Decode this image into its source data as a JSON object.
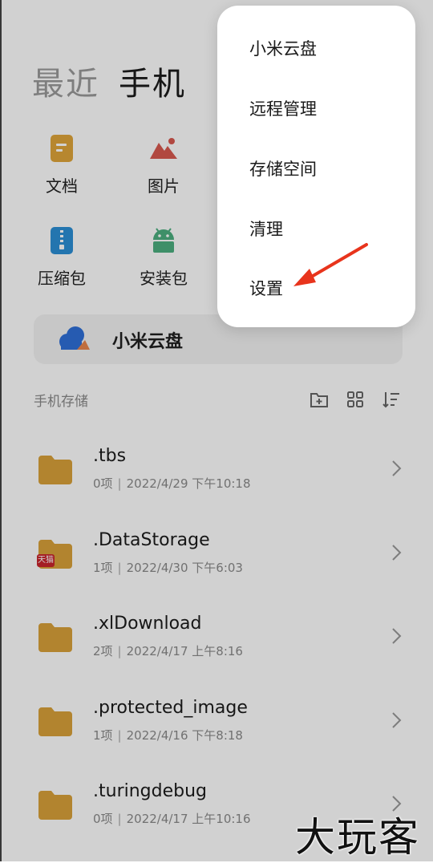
{
  "tabs": {
    "recent": "最近",
    "phone": "手机"
  },
  "categories": [
    {
      "label": "文档",
      "icon": "document-icon",
      "color": "#e0a53a"
    },
    {
      "label": "图片",
      "icon": "picture-icon",
      "color": "#d8584f"
    },
    {
      "label": "压缩包",
      "icon": "zip-icon",
      "color": "#2b8fd6"
    },
    {
      "label": "安装包",
      "icon": "android-icon",
      "color": "#4caf7f"
    }
  ],
  "cloud_card": {
    "label": "小米云盘",
    "icon": "cloud-icon"
  },
  "storage": {
    "title": "手机存储",
    "tools": [
      "new-folder-icon",
      "grid-view-icon",
      "sort-icon"
    ]
  },
  "files": [
    {
      "name": ".tbs",
      "count": "0项",
      "date": "2022/4/29 下午10:18"
    },
    {
      "name": ".DataStorage",
      "count": "1项",
      "date": "2022/4/30 下午6:03",
      "badge": "天猫"
    },
    {
      "name": ".xlDownload",
      "count": "2项",
      "date": "2022/4/17 上午8:16"
    },
    {
      "name": ".protected_image",
      "count": "1项",
      "date": "2022/4/16 下午8:18"
    },
    {
      "name": ".turingdebug",
      "count": "0项",
      "date": "2022/4/17 上午10:16"
    }
  ],
  "meta_separator": "|",
  "menu": [
    "小米云盘",
    "远程管理",
    "存储空间",
    "清理",
    "设置"
  ],
  "annotation": {
    "arrow_color": "#e8341c"
  },
  "watermark": "大玩客",
  "colors": {
    "folder": "#d9a23a",
    "accent_arrow": "#e8341c"
  }
}
